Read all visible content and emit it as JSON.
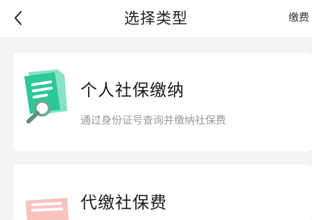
{
  "header": {
    "title": "选择类型",
    "right_action": "缴费"
  },
  "cards": [
    {
      "title": "个人社保缴纳",
      "subtitle": "通过身份证号查询并缴纳社保费",
      "icon": "document-search-icon",
      "icon_color": "#2ec79a"
    },
    {
      "title": "代缴社保费",
      "icon": "document-icon",
      "icon_color": "#f08a86"
    }
  ]
}
